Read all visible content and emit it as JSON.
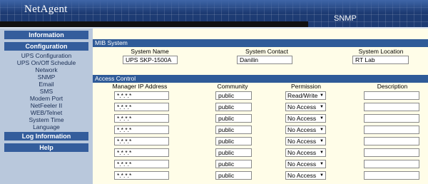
{
  "header": {
    "logo": "NetAgent",
    "page_label": "SNMP"
  },
  "sidebar": {
    "information": "Information",
    "configuration": "Configuration",
    "items": [
      "UPS Configuration",
      "UPS On/Off Schedule",
      "Network",
      "SNMP",
      "Email",
      "SMS",
      "Modem Port",
      "NetFeeler II",
      "WEB/Telnet",
      "System Time",
      "Language"
    ],
    "log_information": "Log Information",
    "help": "Help"
  },
  "mib_system": {
    "title": "MIB System",
    "headers": {
      "name": "System Name",
      "contact": "System Contact",
      "location": "System Location"
    },
    "values": {
      "name": "UPS SKP-1500A",
      "contact": "Danilin",
      "location": "RT Lab"
    }
  },
  "access_control": {
    "title": "Access Control",
    "headers": {
      "ip": "Manager IP Address",
      "community": "Community",
      "permission": "Permission",
      "description": "Description"
    },
    "rows": [
      {
        "ip": "*.*.*.*",
        "community": "public",
        "permission": "Read/Write",
        "description": ""
      },
      {
        "ip": "*.*.*.*",
        "community": "public",
        "permission": "No Access",
        "description": ""
      },
      {
        "ip": "*.*.*.*",
        "community": "public",
        "permission": "No Access",
        "description": ""
      },
      {
        "ip": "*.*.*.*",
        "community": "public",
        "permission": "No Access",
        "description": ""
      },
      {
        "ip": "*.*.*.*",
        "community": "public",
        "permission": "No Access",
        "description": ""
      },
      {
        "ip": "*.*.*.*",
        "community": "public",
        "permission": "No Access",
        "description": ""
      },
      {
        "ip": "*.*.*.*",
        "community": "public",
        "permission": "No Access",
        "description": ""
      },
      {
        "ip": "*.*.*.*",
        "community": "public",
        "permission": "No Access",
        "description": ""
      }
    ]
  }
}
